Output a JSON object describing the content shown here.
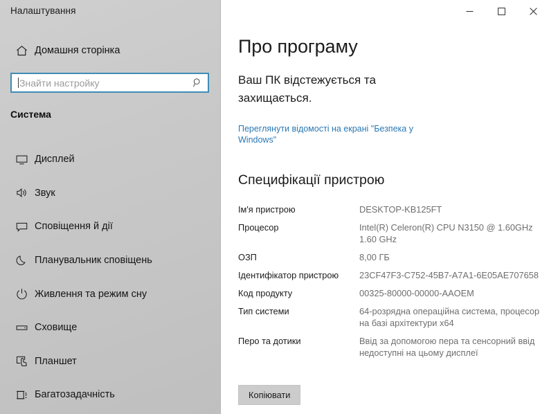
{
  "window": {
    "title": "Налаштування",
    "controls": [
      {
        "name": "minimize",
        "glyph": "minimize-icon"
      },
      {
        "name": "maximize",
        "glyph": "maximize-icon"
      },
      {
        "name": "close",
        "glyph": "close-icon"
      }
    ]
  },
  "sidebar": {
    "home": {
      "label": "Домашня сторінка",
      "icon": "home-icon"
    },
    "search": {
      "value": "",
      "placeholder": "Знайти настройку",
      "icon": "search-icon"
    },
    "group_header": "Система",
    "items": [
      {
        "label": "Дисплей",
        "icon": "display-icon"
      },
      {
        "label": "Звук",
        "icon": "sound-icon"
      },
      {
        "label": "Сповіщення й дії",
        "icon": "notifications-icon"
      },
      {
        "label": "Планувальник сповіщень",
        "icon": "moon-icon"
      },
      {
        "label": "Живлення та режим сну",
        "icon": "power-icon"
      },
      {
        "label": "Сховище",
        "icon": "storage-icon"
      },
      {
        "label": "Планшет",
        "icon": "tablet-icon"
      },
      {
        "label": "Багатозадачність",
        "icon": "multitasking-icon"
      }
    ]
  },
  "main": {
    "page_title": "Про програму",
    "status_text": "Ваш ПК відстежується та захищається.",
    "status_link": "Переглянути відомості на екрані \"Безпека у Windows\"",
    "section_title": "Специфікації пристрою",
    "specs": [
      {
        "label": "Ім'я пристрою",
        "value": "DESKTOP-KB125FT"
      },
      {
        "label": "Процесор",
        "value": "Intel(R) Celeron(R) CPU  N3150  @ 1.60GHz   1.60 GHz"
      },
      {
        "label": "ОЗП",
        "value": "8,00 ГБ"
      },
      {
        "label": "Ідентифікатор пристрою",
        "value": "23CF47F3-C752-45B7-A7A1-6E05AE707658"
      },
      {
        "label": "Код продукту",
        "value": "00325-80000-00000-AAOEM"
      },
      {
        "label": "Тип системи",
        "value": "64-розрядна операційна система, процесор на базі архітектури x64"
      },
      {
        "label": "Перо та дотики",
        "value": "Ввід за допомогою пера та сенсорний ввід недоступні на цьому дисплеї"
      }
    ],
    "copy_button": "Копіювати"
  },
  "colors": {
    "sidebar_bg": "#c9c9c9",
    "accent_link": "#2b78b4",
    "search_border": "#3f8cb5",
    "value_text": "#6e6e6e",
    "label_text": "#1b1b1b",
    "button_bg": "#cccccc"
  }
}
